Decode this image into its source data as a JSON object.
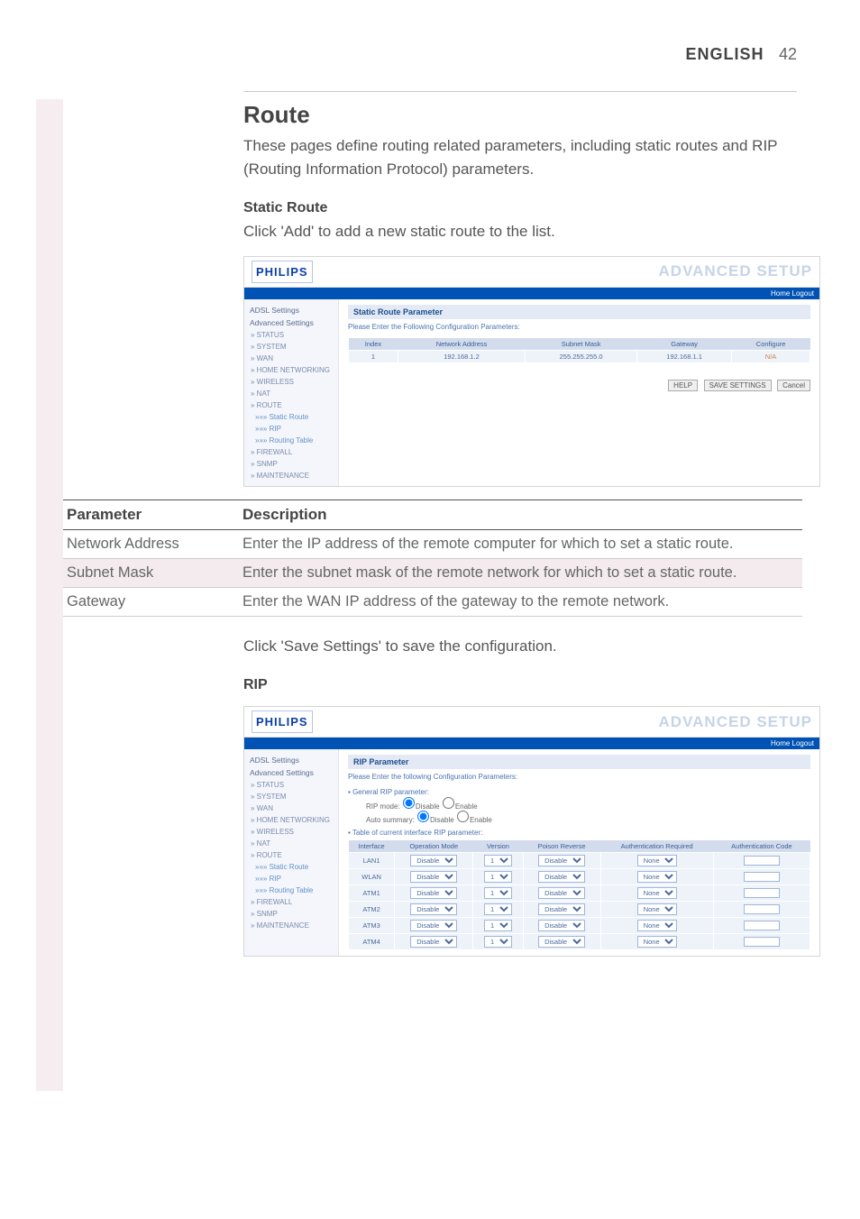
{
  "header": {
    "language": "ENGLISH",
    "page_number": "42"
  },
  "route_section": {
    "title": "Route",
    "intro": "These pages define routing related parameters, including static routes and RIP (Routing Information Protocol) parameters."
  },
  "static": {
    "title": "Static Route",
    "intro": "Click 'Add' to add a new static route to the list."
  },
  "save_line": "Click 'Save Settings' to save the configuration.",
  "rip_title": "RIP",
  "screenshot1": {
    "logo": "PHILIPS",
    "brand": "ADVANCED SETUP",
    "top_links": "Home   Logout",
    "sidebar_hdr1": "ADSL Settings",
    "sidebar_hdr2": "Advanced Settings",
    "menu": [
      "» STATUS",
      "» SYSTEM",
      "» WAN",
      "» HOME NETWORKING",
      "» WIRELESS",
      "» NAT",
      "» ROUTE",
      "»»» Static Route",
      "»»» RIP",
      "»»» Routing Table",
      "» FIREWALL",
      "» SNMP",
      "» MAINTENANCE"
    ],
    "panel_title": "Static Route Parameter",
    "panel_sub": "Please Enter the Following Configuration Parameters:",
    "cols": [
      "Index",
      "Network Address",
      "Subnet Mask",
      "Gateway",
      "Configure"
    ],
    "row": [
      "1",
      "192.168.1.2",
      "255.255.255.0",
      "192.168.1.1",
      "N/A"
    ],
    "btn_help": "HELP",
    "btn_save": "SAVE SETTINGS",
    "btn_cancel": "Cancel"
  },
  "param_table": {
    "head_param": "Parameter",
    "head_desc": "Description",
    "rows": [
      {
        "p": "Network Address",
        "d": "Enter the IP address of the remote computer for which to set a static route."
      },
      {
        "p": "Subnet Mask",
        "d": "Enter the subnet mask of the remote network for which to set a static route."
      },
      {
        "p": "Gateway",
        "d": "Enter the WAN IP address of the gateway to the remote network."
      }
    ]
  },
  "screenshot2": {
    "logo": "PHILIPS",
    "brand": "ADVANCED SETUP",
    "top_links": "Home   Logout",
    "sidebar_hdr1": "ADSL Settings",
    "sidebar_hdr2": "Advanced Settings",
    "menu": [
      "» STATUS",
      "» SYSTEM",
      "» WAN",
      "» HOME NETWORKING",
      "» WIRELESS",
      "» NAT",
      "» ROUTE",
      "»»» Static Route",
      "»»» RIP",
      "»»» Routing Table",
      "» FIREWALL",
      "» SNMP",
      "» MAINTENANCE"
    ],
    "panel_title": "RIP Parameter",
    "panel_sub": "Please Enter the following Configuration Parameters:",
    "gen1": "General RIP parameter:",
    "rip_mode_label": "RIP mode:",
    "auto_label": "Auto summary:",
    "disable": "Disable",
    "enable": "Enable",
    "gen2": "Table of current interface RIP parameter:",
    "cols": [
      "Interface",
      "Operation Mode",
      "Version",
      "Poison Reverse",
      "Authentication Required",
      "Authentication Code"
    ],
    "rows": [
      [
        "LAN1",
        "Disable",
        "1",
        "Disable",
        "None",
        ""
      ],
      [
        "WLAN",
        "Disable",
        "1",
        "Disable",
        "None",
        ""
      ],
      [
        "ATM1",
        "Disable",
        "1",
        "Disable",
        "None",
        ""
      ],
      [
        "ATM2",
        "Disable",
        "1",
        "Disable",
        "None",
        ""
      ],
      [
        "ATM3",
        "Disable",
        "1",
        "Disable",
        "None",
        ""
      ],
      [
        "ATM4",
        "Disable",
        "1",
        "Disable",
        "None",
        ""
      ]
    ]
  }
}
